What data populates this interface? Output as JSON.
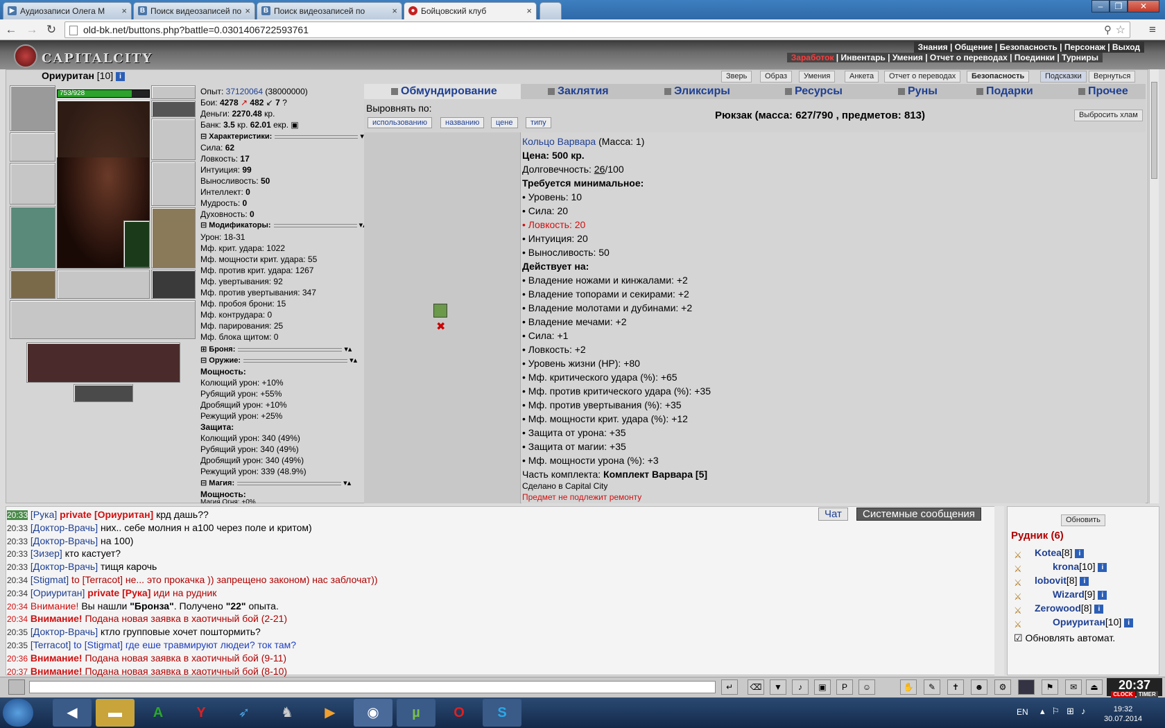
{
  "browser": {
    "tabs": [
      {
        "title": "Аудиозаписи Олега М",
        "icon": "vk-icon"
      },
      {
        "title": "Поиск видеозаписей по",
        "icon": "vk-icon"
      },
      {
        "title": "Поиск видеозаписей по",
        "icon": "vk-icon"
      },
      {
        "title": "Бойцовский клуб",
        "icon": "game-icon"
      }
    ],
    "url": "old-bk.net/buttons.php?battle=0.0301406722593761"
  },
  "game": {
    "logo": "CAPITALCITY",
    "top_menu": [
      "Знания",
      "Общение",
      "Безопасность",
      "Персонаж",
      "Выход"
    ],
    "sub_menu": [
      "Заработок",
      "Инвентарь",
      "Умения",
      "Отчет о переводах",
      "Поединки",
      "Турниры"
    ],
    "right_buttons": [
      "Зверь",
      "Образ",
      "Умения",
      "Анкета",
      "Отчет о переводах",
      "Безопасность",
      "Подсказки",
      "Вернуться"
    ]
  },
  "character": {
    "name": "Ориуритан",
    "level": "[10]",
    "hp": "753/928",
    "hp_fraction": 0.81,
    "exp_label": "Опыт:",
    "exp": "37120064",
    "exp_next": "(38000000)",
    "battles_label": "Бои:",
    "wins": "4278",
    "losses": "482",
    "draws": "7",
    "money_label": "Деньги:",
    "money": "2270.48",
    "money_unit": "кр.",
    "bank_label": "Банк:",
    "bank": "3.5",
    "bank_kr": "кр.",
    "bank_ekr": "62.01",
    "bank_ekr_unit": "екр."
  },
  "stats": {
    "header": "Характеристики:",
    "items": [
      {
        "label": "Сила:",
        "value": "62"
      },
      {
        "label": "Ловкость:",
        "value": "17"
      },
      {
        "label": "Интуиция:",
        "value": "99"
      },
      {
        "label": "Выносливость:",
        "value": "50"
      },
      {
        "label": "Интеллект:",
        "value": "0"
      },
      {
        "label": "Мудрость:",
        "value": "0"
      },
      {
        "label": "Духовность:",
        "value": "0"
      }
    ]
  },
  "modifiers": {
    "header": "Модификаторы:",
    "items": [
      "Урон: 18-31",
      "Мф. крит. удара: 1022",
      "Мф. мощности крит. удара: 55",
      "Мф. против крит. удара: 1267",
      "Мф. увертывания: 92",
      "Мф. против увертывания: 347",
      "Мф. пробоя брони: 15",
      "Мф. контрудара: 0",
      "Мф. парирования: 25",
      "Мф. блока щитом: 0"
    ]
  },
  "armor_header": "Броня:",
  "weapon": {
    "header": "Оружие:",
    "power_label": "Мощность:",
    "power": [
      "Колющий урон: +10%",
      "Рубящий урон: +55%",
      "Дробящий урон: +10%",
      "Режущий урон: +25%"
    ],
    "defense_label": "Защита:",
    "defense": [
      "Колющий урон: 340 (49%)",
      "Рубящий урон: 340 (49%)",
      "Дробящий урон: 340 (49%)",
      "Режущий урон: 339 (48.9%)"
    ]
  },
  "magic": {
    "header": "Магия:",
    "power_label": "Мощность:",
    "partial": "Магия Огня: +0%"
  },
  "inventory": {
    "tabs": [
      "Обмундирование",
      "Заклятия",
      "Эликсиры",
      "Ресурсы",
      "Руны",
      "Подарки",
      "Прочее"
    ],
    "sort_label": "Выровнять по:",
    "sort_buttons": [
      "использованию",
      "названию",
      "цене",
      "типу"
    ],
    "backpack": "Рюкзак (масса: 627/790 , предметов: 813)",
    "discard_button": "Выбросить хлам"
  },
  "item": {
    "name": "Кольцо Варвара",
    "mass": "(Масса: 1)",
    "price": "Цена: 500 кр.",
    "durability_label": "Долговечность:",
    "durability_current": "26",
    "durability_max": "/100",
    "req_header": "Требуется минимальное:",
    "requirements": [
      {
        "text": "• Уровень: 10",
        "unmet": false
      },
      {
        "text": "• Сила: 20",
        "unmet": false
      },
      {
        "text": "• Ловкость: 20",
        "unmet": true
      },
      {
        "text": "• Интуиция: 20",
        "unmet": false
      },
      {
        "text": "• Выносливость: 50",
        "unmet": false
      }
    ],
    "effects_header": "Действует на:",
    "effects": [
      "• Владение ножами и кинжалами: +2",
      "• Владение топорами и секирами: +2",
      "• Владение молотами и дубинами: +2",
      "• Владение мечами: +2",
      "• Сила: +1",
      "• Ловкость: +2",
      "• Уровень жизни (HP): +80",
      "• Мф. критического удара (%): +65",
      "• Мф. против критического удара (%): +35",
      "• Мф. против увертывания (%): +35",
      "• Мф. мощности крит. удара (%): +12",
      "• Защита от урона: +35",
      "• Защита от магии: +35",
      "• Мф. мощности урона (%): +3"
    ],
    "set_label": "Часть комплекта:",
    "set_name": "Комплект Варвара [5]",
    "made_in": "Сделано в Capital City",
    "no_repair": "Предмет не подлежит ремонту"
  },
  "chat": {
    "tabs": [
      "Чат",
      "Системные сообщения"
    ],
    "lines": [
      {
        "time": "20:33",
        "parts": [
          [
            "nick",
            "Рука"
          ],
          [
            "red",
            " private [Ориуритан]"
          ],
          [
            "txt",
            " крд дашь??"
          ]
        ]
      },
      {
        "time": "20:33",
        "parts": [
          [
            "nick",
            "Доктор-Врачь"
          ],
          [
            "txt",
            " них.. себе молния н а100 через поле и критом)"
          ]
        ]
      },
      {
        "time": "20:33",
        "parts": [
          [
            "nick",
            "Доктор-Врачь"
          ],
          [
            "txt",
            " на 100)"
          ]
        ]
      },
      {
        "time": "20:33",
        "parts": [
          [
            "nick",
            "Зизер"
          ],
          [
            "txt",
            " кто кастует?"
          ]
        ]
      },
      {
        "time": "20:33",
        "parts": [
          [
            "nick",
            "Доктор-Врачь"
          ],
          [
            "txt",
            " тищя карочь"
          ]
        ]
      },
      {
        "time": "20:34",
        "parts": [
          [
            "nick",
            "Stigmat"
          ],
          [
            "dark",
            " to [Terracot] не... это прокачка )) запрещено законом) нас заблочат))"
          ]
        ]
      },
      {
        "time": "20:34",
        "parts": [
          [
            "nick",
            "Ориуритан"
          ],
          [
            "red",
            " private [Рука]"
          ],
          [
            "dark",
            " иди на рудник"
          ]
        ]
      },
      {
        "time": "20:34",
        "parts": [
          [
            "sys",
            "Внимание!"
          ],
          [
            "txt",
            " Вы нашли "
          ],
          [
            "b",
            "\"Бронза\""
          ],
          [
            "txt",
            ". Получено "
          ],
          [
            "b",
            "\"22\""
          ],
          [
            "txt",
            " опыта."
          ]
        ]
      },
      {
        "time": "20:34",
        "parts": [
          [
            "sysb",
            "Внимание!"
          ],
          [
            "dark",
            " Подана новая заявка в хаотичный бой (2-21)"
          ]
        ]
      },
      {
        "time": "20:35",
        "parts": [
          [
            "nick",
            "Доктор-Врачь"
          ],
          [
            "txt",
            " ктло групповые хочет поштормить?"
          ]
        ]
      },
      {
        "time": "20:35",
        "parts": [
          [
            "nick",
            "Terracot"
          ],
          [
            "blue",
            " to [Stigmat] где еше травмируют людеи? ток там?"
          ]
        ]
      },
      {
        "time": "20:36",
        "parts": [
          [
            "sysb",
            "Внимание!"
          ],
          [
            "dark",
            " Подана новая заявка в хаотичный бой (9-11)"
          ]
        ]
      },
      {
        "time": "20:37",
        "parts": [
          [
            "sysb",
            "Внимание!"
          ],
          [
            "dark",
            " Подана новая заявка в хаотичный бой (8-10)"
          ]
        ]
      }
    ]
  },
  "room": {
    "refresh_button": "Обновить",
    "title": "Рудник (6)",
    "players": [
      {
        "name": "Kotea",
        "level": "[8]"
      },
      {
        "name": "krona",
        "level": "[10]"
      },
      {
        "name": "lobovit",
        "level": "[8]"
      },
      {
        "name": "Wizard",
        "level": "[9]"
      },
      {
        "name": "Zerowood",
        "level": "[8]"
      },
      {
        "name": "Ориуритан",
        "level": "[10]"
      }
    ],
    "auto_refresh": "Обновлять автомат."
  },
  "game_clock": {
    "time": "20:37",
    "clock_label": "CLOCK",
    "timer_label": "TIMER"
  },
  "taskbar": {
    "lang": "EN",
    "time": "19:32",
    "date": "30.07.2014"
  }
}
